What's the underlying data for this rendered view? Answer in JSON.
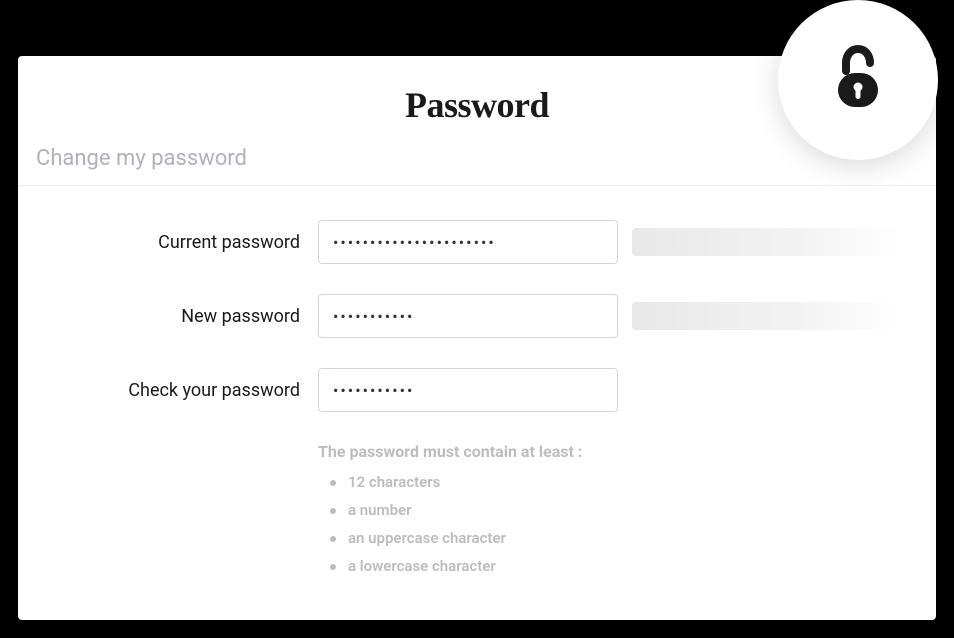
{
  "header": {
    "title": "Password",
    "subtitle": "Change my password"
  },
  "icons": {
    "lock": "unlock-icon"
  },
  "fields": {
    "current": {
      "label": "Current password",
      "value": "••••••••••••••••••••••"
    },
    "new": {
      "label": "New password",
      "value": "•••••••••••"
    },
    "check": {
      "label": "Check your password",
      "value": "•••••••••••"
    }
  },
  "requirements": {
    "title": "The password must contain at least :",
    "items": [
      "12 characters",
      "a number",
      "an uppercase character",
      "a lowercase character"
    ]
  }
}
